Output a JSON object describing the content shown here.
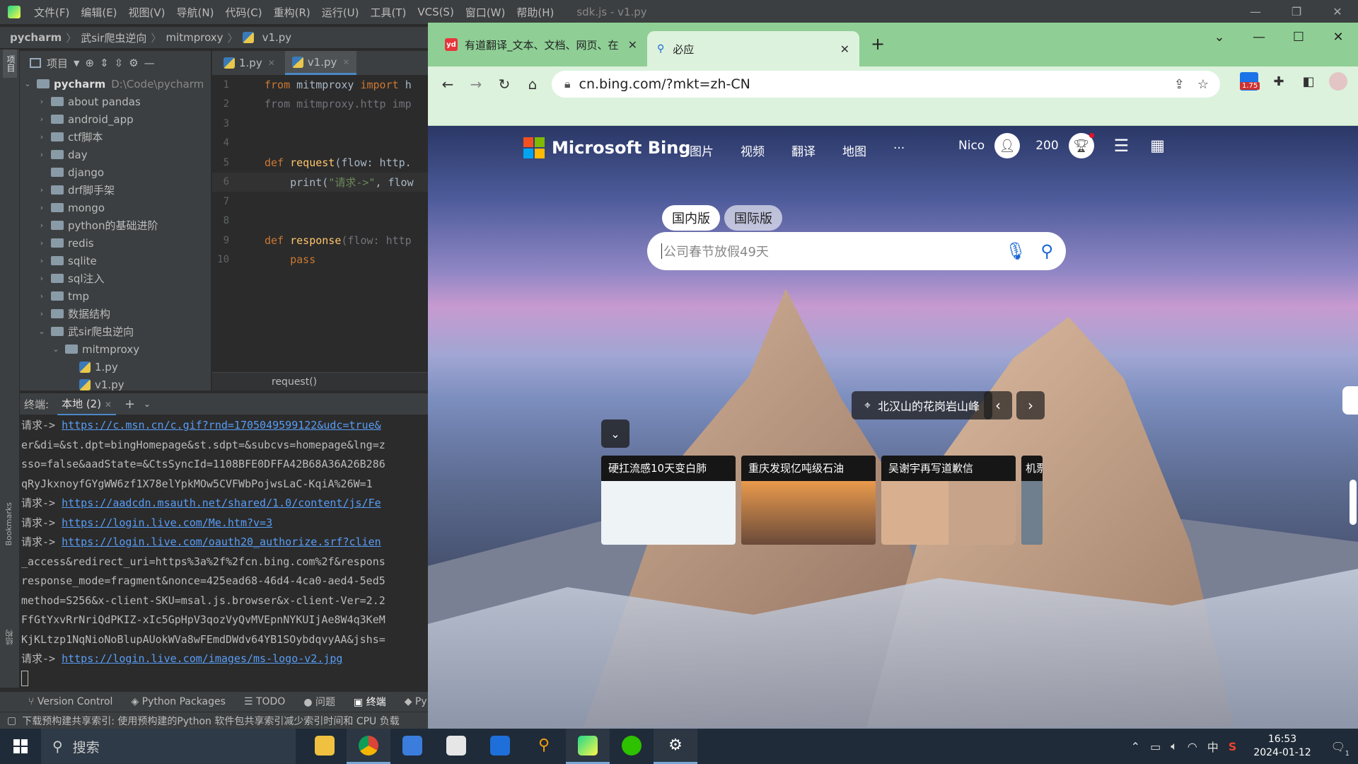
{
  "ide": {
    "menus": [
      "文件(F)",
      "编辑(E)",
      "视图(V)",
      "导航(N)",
      "代码(C)",
      "重构(R)",
      "运行(U)",
      "工具(T)",
      "VCS(S)",
      "窗口(W)",
      "帮助(H)"
    ],
    "window_title": "sdk.js - v1.py",
    "breadcrumb": [
      "pycharm",
      "武sir爬虫逆向",
      "mitmproxy",
      "v1.py"
    ],
    "project_label": "项目",
    "left_strip_label": "项目",
    "bookmarks_label": "Bookmarks",
    "structure_label": "结构",
    "tree": {
      "root_name": "pycharm",
      "root_path": "D:\\Code\\pycharm",
      "folders": [
        "about pandas",
        "android_app",
        "ctf脚本",
        "day",
        "django",
        "drf脚手架",
        "mongo",
        "python的基础进阶",
        "redis",
        "sqlite",
        "sql注入",
        "tmp",
        "数据结构"
      ],
      "expanded_folder": "武sir爬虫逆向",
      "subfolder": "mitmproxy",
      "files": [
        "1.py",
        "v1.py"
      ]
    },
    "editor_tabs": [
      "1.py",
      "v1.py"
    ],
    "code": [
      {
        "n": "1",
        "parts": [
          [
            "kw",
            "from "
          ],
          [
            "txt",
            "mitmproxy "
          ],
          [
            "kw",
            "import "
          ],
          [
            "txt",
            "h"
          ]
        ]
      },
      {
        "n": "2",
        "parts": [
          [
            "dim",
            "from mitmproxy.http imp"
          ]
        ]
      },
      {
        "n": "3",
        "parts": []
      },
      {
        "n": "4",
        "parts": []
      },
      {
        "n": "5",
        "parts": [
          [
            "kw",
            "def "
          ],
          [
            "fn",
            "request"
          ],
          [
            "txt",
            "(flow: http."
          ]
        ]
      },
      {
        "n": "6",
        "parts": [
          [
            "txt",
            "    print("
          ],
          [
            "str",
            "\"请求->\""
          ],
          [
            "txt",
            ", flow"
          ]
        ]
      },
      {
        "n": "7",
        "parts": []
      },
      {
        "n": "8",
        "parts": []
      },
      {
        "n": "9",
        "parts": [
          [
            "kw",
            "def "
          ],
          [
            "fn",
            "response"
          ],
          [
            "dim",
            "(flow: http"
          ]
        ]
      },
      {
        "n": "10",
        "parts": [
          [
            "kw",
            "    pass"
          ]
        ]
      }
    ],
    "editor_crumb": "request()",
    "terminal_label": "终端:",
    "terminal_tab": "本地 (2)",
    "terminal_lines": [
      {
        "prefix": "请求-> ",
        "link": "https://c.msn.cn/c.gif?rnd=1705049599122&udc=true&",
        "rest": ""
      },
      {
        "prefix": "",
        "link": "",
        "rest": "er&di=&st.dpt=bingHomepage&st.sdpt=&subcvs=homepage&lng=z"
      },
      {
        "prefix": "",
        "link": "",
        "rest": "sso=false&aadState=&CtsSyncId=1108BFE0DFFA42B68A36A26B286"
      },
      {
        "prefix": "",
        "link": "",
        "rest": "qRyJkxnoyfGYgWW6zf1X78elYpkMOw5CVFWbPojwsLaC-KqiA%26W=1"
      },
      {
        "prefix": "请求-> ",
        "link": "https://aadcdn.msauth.net/shared/1.0/content/js/Fe",
        "rest": ""
      },
      {
        "prefix": "请求-> ",
        "link": "https://login.live.com/Me.htm?v=3",
        "rest": ""
      },
      {
        "prefix": "请求-> ",
        "link": "https://login.live.com/oauth20_authorize.srf?clien",
        "rest": ""
      },
      {
        "prefix": "",
        "link": "",
        "rest": "_access&redirect_uri=https%3a%2f%2fcn.bing.com%2f&respons"
      },
      {
        "prefix": "",
        "link": "",
        "rest": "response_mode=fragment&nonce=425ead68-46d4-4ca0-aed4-5ed5"
      },
      {
        "prefix": "",
        "link": "",
        "rest": "method=S256&x-client-SKU=msal.js.browser&x-client-Ver=2.2"
      },
      {
        "prefix": "",
        "link": "",
        "rest": "FfGtYxvRrNriQdPKIZ-xIc5GpHpV3qozVyQvMVEpnNYKUIjAe8W4q3KeM"
      },
      {
        "prefix": "",
        "link": "",
        "rest": "KjKLtzp1NqNioNoBlupAUokWVa8wFEmdDWdv64YB1SOybdqvyAA&jshs="
      },
      {
        "prefix": "请求-> ",
        "link": "https://login.live.com/images/ms-logo-v2.jpg",
        "rest": ""
      }
    ],
    "bottom_tools": [
      "Version Control",
      "Python Packages",
      "TODO",
      "问题",
      "终端",
      "Py"
    ],
    "status_text": "下载预构建共享索引: 使用预构建的Python 软件包共享索引减少索引时间和 CPU 负载"
  },
  "browser": {
    "tabs": [
      {
        "favicon": "yd",
        "title": "有道翻译_文本、文档、网页、在"
      },
      {
        "favicon": "🔍",
        "title": "必应"
      }
    ],
    "url": "cn.bing.com/?mkt=zh-CN",
    "ext_badge": "1.75",
    "colors": {
      "accent": "#8fcf95",
      "toolbar": "#dcf2dd",
      "link": "#589df6"
    }
  },
  "bing": {
    "logo_text": "Microsoft Bing",
    "nav": [
      "图片",
      "视频",
      "翻译",
      "地图",
      "···"
    ],
    "user": "Nico",
    "points": "200",
    "scope_tabs": [
      "国内版",
      "国际版"
    ],
    "search_placeholder": "公司春节放假49天",
    "caption": "北汉山的花岗岩山峰",
    "cards": [
      {
        "title": "硬扛流感10天变白肺",
        "color": "#eef3f6"
      },
      {
        "title": "重庆发现亿吨级石油",
        "color": "#d88640"
      },
      {
        "title": "吴谢宇再写道歉信",
        "color": "#d9b08f"
      },
      {
        "title": "机票",
        "color": "#6f7f8d"
      }
    ]
  },
  "taskbar": {
    "search_text": "搜索",
    "time": "16:53",
    "date": "2024-01-12",
    "ime": "中",
    "notification_count": "1"
  }
}
